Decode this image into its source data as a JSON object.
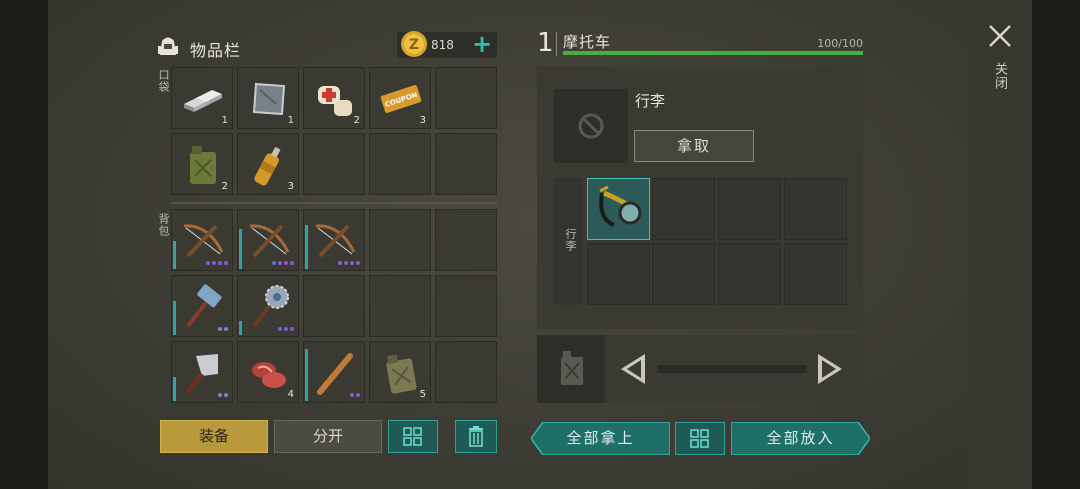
{
  "inventory": {
    "title": "物品栏",
    "coins": "818",
    "add_symbol": "+",
    "pocket_label": "口袋",
    "backpack_label": "背包",
    "pocket_slots": [
      {
        "item": "metal-ingots-icon",
        "count": "1"
      },
      {
        "item": "metal-plate-icon",
        "count": "1"
      },
      {
        "item": "bandage-icon",
        "count": "2"
      },
      {
        "item": "coupon-ticket-icon",
        "count": "3"
      },
      {
        "item": "",
        "count": ""
      },
      {
        "item": "jerrycan-icon",
        "count": "2"
      },
      {
        "item": "bottle-icon",
        "count": "3"
      },
      {
        "item": "",
        "count": ""
      },
      {
        "item": "",
        "count": ""
      },
      {
        "item": "",
        "count": ""
      }
    ],
    "coupon_text": "COUPON",
    "backpack_slots": [
      {
        "item": "crossbow-icon",
        "count": ""
      },
      {
        "item": "crossbow-icon",
        "count": ""
      },
      {
        "item": "crossbow-icon",
        "count": ""
      },
      {
        "item": "",
        "count": ""
      },
      {
        "item": "",
        "count": ""
      },
      {
        "item": "sledgehammer-icon",
        "count": ""
      },
      {
        "item": "sawblade-mace-icon",
        "count": ""
      },
      {
        "item": "",
        "count": ""
      },
      {
        "item": "",
        "count": ""
      },
      {
        "item": "",
        "count": ""
      },
      {
        "item": "cleaver-icon",
        "count": ""
      },
      {
        "item": "raw-meat-icon",
        "count": "4"
      },
      {
        "item": "baseball-bat-icon",
        "count": ""
      },
      {
        "item": "jerrycan-icon",
        "count": "5"
      },
      {
        "item": "",
        "count": ""
      }
    ],
    "buttons": {
      "equip": "装备",
      "split": "分开"
    }
  },
  "vehicle": {
    "index": "1",
    "name": "摩托车",
    "hp_text": "100/100",
    "hp_fraction": 1.0,
    "luggage_title": "行李",
    "take_button": "拿取",
    "grid_label": "行李",
    "grid_item": "hunting-horn-icon"
  },
  "actions": {
    "take_all": "全部拿上",
    "put_all": "全部放入"
  },
  "close_label": "关闭",
  "colors": {
    "accent_teal": "#2fc0b4",
    "equip_gold": "#b89a3c",
    "hp_green": "#3fb33a"
  }
}
